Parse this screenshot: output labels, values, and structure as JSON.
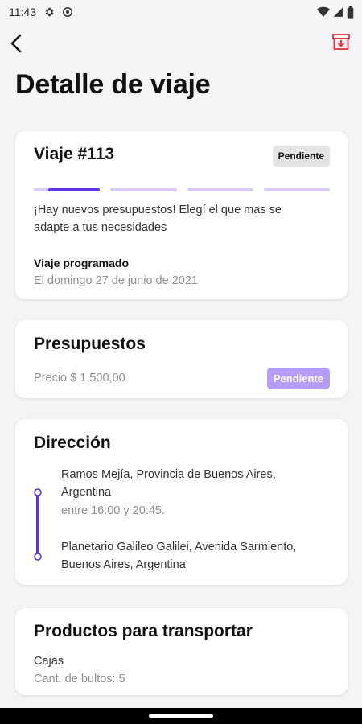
{
  "status_bar": {
    "time": "11:43",
    "icons": [
      "gear-icon",
      "sync-icon",
      "wifi-icon",
      "signal-icon",
      "battery-icon"
    ]
  },
  "top_bar": {
    "back_icon": "back-arrow-icon",
    "archive_icon": "archive-icon",
    "archive_color": "#e0303a"
  },
  "page": {
    "title": "Detalle de viaje"
  },
  "trip_card": {
    "title": "Viaje #113",
    "status": "Pendiente",
    "progress_active_step": 1,
    "progress_total_steps": 4,
    "message": "¡Hay nuevos presupuestos! Elegí el que mas se adapte a tus necesidades",
    "scheduled_label": "Viaje programado",
    "scheduled_date": "El domingo 27 de junio de 2021"
  },
  "budget_card": {
    "title": "Presupuestos",
    "price": "Precio $ 1.500,00",
    "status": "Pendiente"
  },
  "address_card": {
    "title": "Dirección",
    "origin": "Ramos Mejía, Provincia de Buenos Aires, Argentina",
    "time_window": "entre 16:00 y 20:45.",
    "destination": "Planetario Galileo Galilei, Avenida Sarmiento, Buenos Aires, Argentina"
  },
  "products_card": {
    "title": "Productos para transportar",
    "item_name": "Cajas",
    "item_count": "Cant. de bultos: 5"
  },
  "colors": {
    "accent": "#5b34e0",
    "accent_light": "#d6ccf7",
    "badge_purple": "#b59cf5",
    "badge_grey": "#e4e4e4"
  }
}
